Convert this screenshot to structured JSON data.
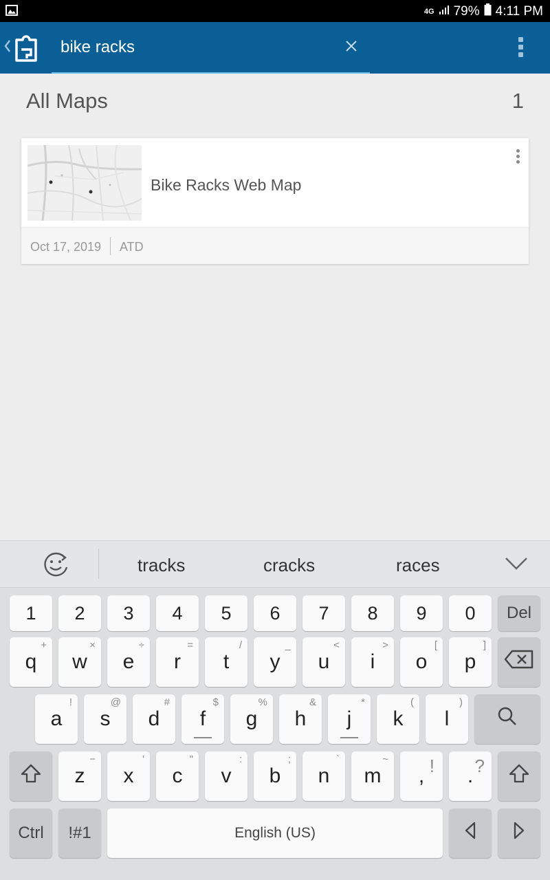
{
  "status_bar": {
    "network": "4G",
    "battery": "79%",
    "time": "4:11 PM"
  },
  "app_bar": {
    "search_value": "bike racks"
  },
  "results": {
    "title": "All Maps",
    "count": "1",
    "items": [
      {
        "title": "Bike Racks Web Map",
        "date": "Oct 17, 2019",
        "owner": "ATD"
      }
    ]
  },
  "keyboard": {
    "suggestions": [
      "tracks",
      "cracks",
      "races"
    ],
    "number_row": [
      "1",
      "2",
      "3",
      "4",
      "5",
      "6",
      "7",
      "8",
      "9",
      "0"
    ],
    "del_label": "Del",
    "row1": [
      {
        "k": "q",
        "s": "+"
      },
      {
        "k": "w",
        "s": "×"
      },
      {
        "k": "e",
        "s": "÷"
      },
      {
        "k": "r",
        "s": "="
      },
      {
        "k": "t",
        "s": "/"
      },
      {
        "k": "y",
        "s": "_"
      },
      {
        "k": "u",
        "s": "<"
      },
      {
        "k": "i",
        "s": ">"
      },
      {
        "k": "o",
        "s": "["
      },
      {
        "k": "p",
        "s": "]"
      }
    ],
    "row2": [
      {
        "k": "a",
        "s": "!"
      },
      {
        "k": "s",
        "s": "@"
      },
      {
        "k": "d",
        "s": "#"
      },
      {
        "k": "f",
        "s": "$"
      },
      {
        "k": "g",
        "s": "%"
      },
      {
        "k": "h",
        "s": "&"
      },
      {
        "k": "j",
        "s": "*"
      },
      {
        "k": "k",
        "s": "("
      },
      {
        "k": "l",
        "s": ")"
      }
    ],
    "row3": [
      {
        "k": "z",
        "s": "−"
      },
      {
        "k": "x",
        "s": "'"
      },
      {
        "k": "c",
        "s": "\""
      },
      {
        "k": "v",
        "s": ":"
      },
      {
        "k": "b",
        "s": ";"
      },
      {
        "k": "n",
        "s": "`"
      },
      {
        "k": "m",
        "s": "~"
      }
    ],
    "comma_key": ",",
    "comma_alt": "!",
    "period_key": ".",
    "period_alt": "?",
    "ctrl_label": "Ctrl",
    "symbols_label": "!#1",
    "space_label": "English (US)"
  }
}
